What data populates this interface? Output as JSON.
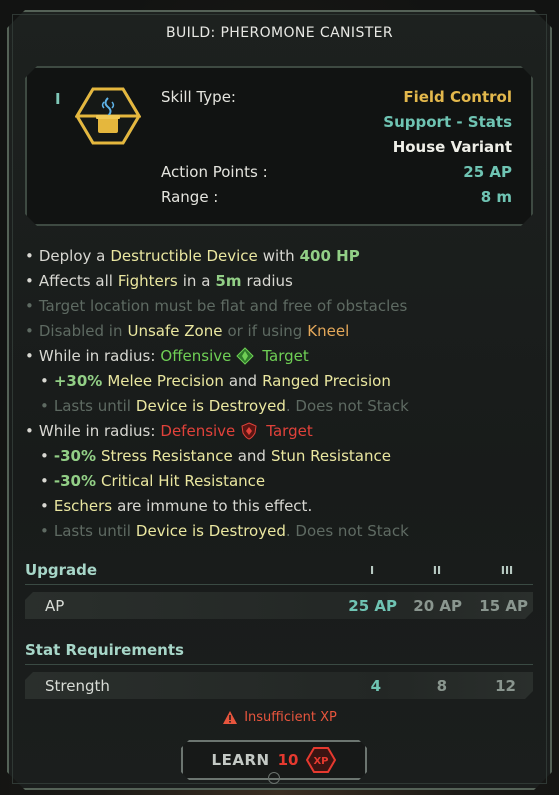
{
  "title": "BUILD: PHEROMONE CANISTER",
  "header": {
    "tier": "I",
    "icon": "pheromone-canister-icon",
    "skill_type_label": "Skill Type:",
    "skill_type_value": "Field Control",
    "subtype_value": "Support - Stats",
    "variant_value": "House Variant",
    "ap_label": "Action Points :",
    "ap_value": "25 AP",
    "range_label": "Range :",
    "range_value": "8 m"
  },
  "description": {
    "l1": {
      "a": "Deploy a",
      "b": "Destructible Device",
      "c": "with",
      "d": "400 HP"
    },
    "l2": {
      "a": "Affects all",
      "b": "Fighters",
      "c": "in a",
      "d": "5m",
      "e": "radius"
    },
    "l3": {
      "a": "Target location must be flat and free of obstacles"
    },
    "l4": {
      "a": "Disabled in",
      "b": "Unsafe Zone",
      "c": "or if using",
      "d": "Kneel"
    },
    "l5": {
      "a": "While in radius:",
      "b": "Offensive",
      "c": "Target"
    },
    "l6": {
      "a": "+30%",
      "b": "Melee Precision",
      "c": "and",
      "d": "Ranged Precision"
    },
    "l7": {
      "a": "Lasts until",
      "b": "Device is Destroyed",
      "c": ". Does not Stack"
    },
    "l8": {
      "a": "While in radius:",
      "b": "Defensive",
      "c": "Target"
    },
    "l9": {
      "a": "-30%",
      "b": "Stress Resistance",
      "c": "and",
      "d": "Stun Resistance"
    },
    "l10": {
      "a": "-30%",
      "b": "Critical Hit Resistance"
    },
    "l11": {
      "a": "Eschers",
      "b": "are immune to this effect."
    },
    "l12": {
      "a": "Lasts until",
      "b": "Device is Destroyed",
      "c": ". Does not Stack"
    }
  },
  "upgrade": {
    "heading": "Upgrade",
    "tiers": [
      "I",
      "II",
      "III"
    ],
    "row_label": "AP",
    "values": [
      "25 AP",
      "20 AP",
      "15 AP"
    ]
  },
  "stat_requirements": {
    "heading": "Stat Requirements",
    "row_label": "Strength",
    "values": [
      "4",
      "8",
      "12"
    ]
  },
  "warning": "Insufficient XP",
  "learn": {
    "label": "LEARN",
    "cost": "10",
    "currency": "XP"
  },
  "colors": {
    "accent_teal": "#6fc4b3",
    "gold": "#e3b84c",
    "xp_red": "#e5392f"
  }
}
